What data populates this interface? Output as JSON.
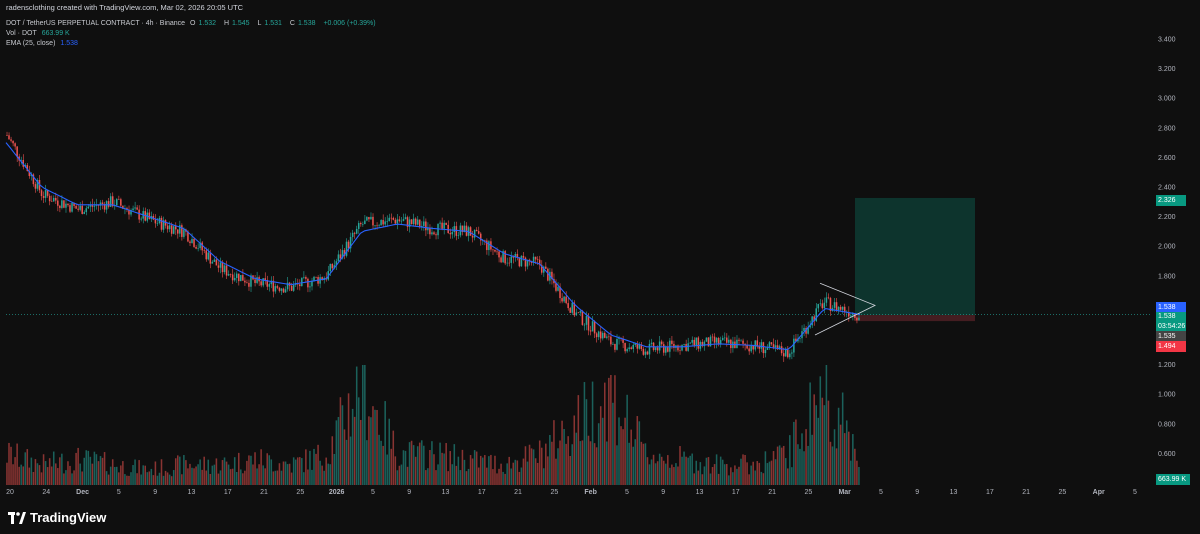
{
  "header": {
    "credit": "radensclothing created with TradingView.com, Mar 02, 2026 20:05 UTC",
    "symbol": "DOT / TetherUS PERPETUAL CONTRACT · 4h · Binance",
    "ohlc": {
      "o_label": "O",
      "o": "1.532",
      "h_label": "H",
      "h": "1.545",
      "l_label": "L",
      "l": "1.531",
      "c_label": "C",
      "c": "1.538",
      "change": "+0.006 (+0.39%)"
    },
    "volume": {
      "label": "Vol · DOT",
      "value": "663.99 K"
    },
    "ema": {
      "label": "EMA (25, close)",
      "value": "1.538"
    }
  },
  "price_axis": {
    "ticks": [
      "3.400",
      "3.200",
      "3.000",
      "2.800",
      "2.600",
      "2.400",
      "2.200",
      "2.000",
      "1.800",
      "1.600",
      "1.400",
      "1.200",
      "1.000",
      "0.800",
      "0.600"
    ],
    "ema_badge": "1.538",
    "last_price": "1.538",
    "countdown": "03:54:26",
    "entry_badge": "1.535",
    "stop_badge": "1.494",
    "target_badge": "2.326",
    "volume_badge": "663.99 K"
  },
  "time_axis": {
    "ticks": [
      "20",
      "24",
      "Dec",
      "5",
      "9",
      "13",
      "17",
      "21",
      "25",
      "2026",
      "5",
      "9",
      "13",
      "17",
      "21",
      "25",
      "Feb",
      "5",
      "9",
      "13",
      "17",
      "21",
      "25",
      "Mar",
      "5",
      "9",
      "13",
      "17",
      "21",
      "25",
      "Apr",
      "5"
    ]
  },
  "colors": {
    "background": "#0f0f0f",
    "up": "#26a69a",
    "down": "#ef5350",
    "ema": "#2962ff",
    "profit_zone": "#0d3b33",
    "loss_zone": "#4a1f23",
    "triangle": "#d1d4dc"
  },
  "chart_data": {
    "type": "candlestick",
    "series": [
      {
        "name": "DOT / TetherUS PERPETUAL CONTRACT",
        "x": [
          "Nov 20",
          "Nov 24",
          "Dec 1",
          "Dec 5",
          "Dec 9",
          "Dec 13",
          "Dec 17",
          "Dec 21",
          "Dec 25",
          "Jan 1",
          "Jan 5",
          "Jan 9",
          "Jan 13",
          "Jan 17",
          "Jan 21",
          "Jan 25",
          "Feb 1",
          "Feb 5",
          "Feb 9",
          "Feb 13",
          "Feb 17",
          "Feb 21",
          "Feb 25",
          "Mar 1",
          "Mar 2"
        ],
        "close": [
          2.75,
          2.35,
          2.25,
          2.3,
          2.18,
          2.1,
          1.85,
          1.75,
          1.72,
          1.8,
          2.15,
          2.18,
          2.12,
          2.1,
          1.92,
          1.88,
          1.55,
          1.35,
          1.3,
          1.33,
          1.35,
          1.33,
          1.28,
          1.62,
          1.538
        ]
      },
      {
        "name": "EMA (25, close)",
        "x": [
          "Nov 20",
          "Nov 24",
          "Dec 1",
          "Dec 5",
          "Dec 9",
          "Dec 13",
          "Dec 17",
          "Dec 21",
          "Dec 25",
          "Jan 1",
          "Jan 5",
          "Jan 9",
          "Jan 13",
          "Jan 17",
          "Jan 21",
          "Jan 25",
          "Feb 1",
          "Feb 5",
          "Feb 9",
          "Feb 13",
          "Feb 17",
          "Feb 21",
          "Feb 25",
          "Mar 1",
          "Mar 2"
        ],
        "values": [
          2.7,
          2.4,
          2.28,
          2.28,
          2.2,
          2.12,
          1.9,
          1.78,
          1.74,
          1.78,
          2.1,
          2.15,
          2.12,
          2.1,
          1.95,
          1.88,
          1.6,
          1.4,
          1.32,
          1.32,
          1.34,
          1.33,
          1.3,
          1.58,
          1.538
        ]
      }
    ],
    "volume": [
      0.3,
      0.2,
      0.25,
      0.2,
      0.15,
      0.2,
      0.2,
      0.25,
      0.2,
      0.3,
      1.0,
      0.3,
      0.3,
      0.25,
      0.2,
      0.3,
      0.6,
      0.9,
      0.3,
      0.25,
      0.2,
      0.2,
      0.3,
      0.95,
      0.3
    ],
    "position": {
      "entry": 1.535,
      "stop": 1.494,
      "target": 2.326
    },
    "ylim": [
      0.5,
      3.5
    ]
  }
}
